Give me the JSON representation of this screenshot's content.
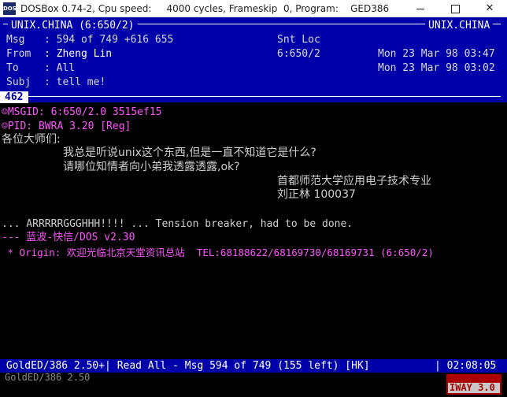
{
  "window": {
    "app_icon_text": "DOS",
    "title": "DOSBox 0.74-2, Cpu speed:     4000 cycles, Frameskip  0, Program:    GED386"
  },
  "header": {
    "area_left": "UNIX.CHINA (6:650/2)",
    "area_right": "UNIX.CHINA",
    "msg_label": "Msg",
    "msg_value": ": 594 of 749 +616 655",
    "flags": "Snt Loc",
    "from_label": "From",
    "from_value": ": Zheng Lin",
    "from_addr": "6:650/2",
    "from_date": "Mon 23 Mar 98 03:47",
    "to_label": "To",
    "to_value": ": All",
    "to_date": "Mon 23 Mar 98 03:02",
    "subj_label": "Subj",
    "subj_value": ": tell me!",
    "msg_number": "462"
  },
  "message": {
    "msgid": "☺MSGID: 6:650/2.0 3515ef15",
    "pid": "☺PID: BWRA 3.20 [Reg]",
    "greeting": "各位大师们:",
    "line1": "我总是听说unix这个东西,但是一直不知道它是什么?",
    "line2": "请哪位知情者向小弟我透露透露,ok?",
    "sig1": "首都师范大学应用电子技术专业",
    "sig2": "刘正林 100037",
    "tagline": "... ARRRRRGGGHHH!!!! ... Tension breaker, had to be done.",
    "tearline": "--- 蓝波-快信/DOS v2.30",
    "origin": " * Origin: 欢迎光临北京天堂资讯总站  TEL:68188622/68169730/68169731 (6:650/2)"
  },
  "status": {
    "left": " GoldED/386 2.50+| Read All - Msg 594 of 749 (155 left) [HK]",
    "right": "| 02:08:05"
  },
  "bottom": {
    "under_text": "GoldED/386 2.50",
    "tsr_label": "IWAY 3.0"
  },
  "colors": {
    "header_bg": "#0000aa",
    "kludge": "#ff55ff",
    "body_text": "#cfcfcf",
    "tsr": "#aa0000"
  }
}
